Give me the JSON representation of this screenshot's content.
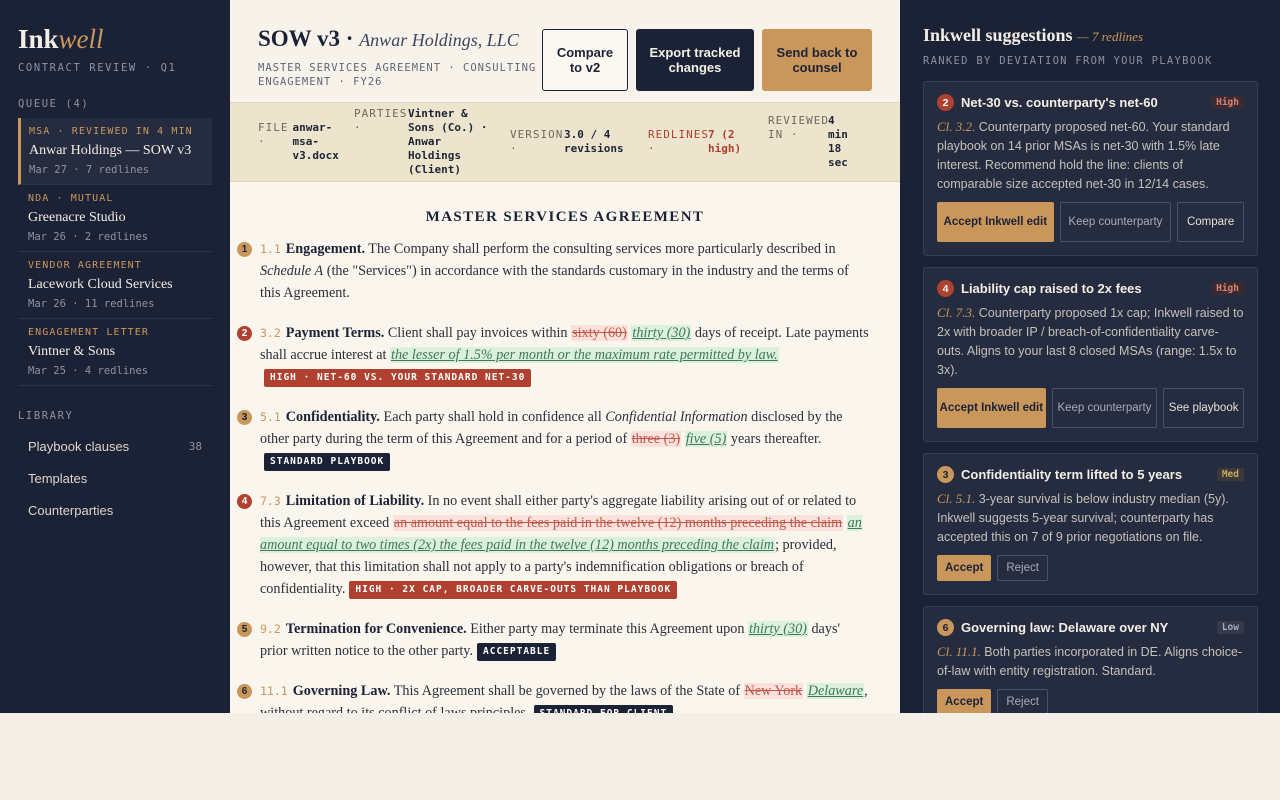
{
  "sidebar": {
    "brand_a": "Ink",
    "brand_b": "well",
    "brand_sub": "CONTRACT REVIEW · Q1",
    "queue_heading": "QUEUE (4)",
    "queue": [
      {
        "tag": "MSA · REVIEWED IN 4 MIN",
        "title": "Anwar Holdings — SOW v3",
        "meta": "Mar 27 · 7 redlines"
      },
      {
        "tag": "NDA · MUTUAL",
        "title": "Greenacre Studio",
        "meta": "Mar 26 · 2 redlines"
      },
      {
        "tag": "VENDOR AGREEMENT",
        "title": "Lacework Cloud Services",
        "meta": "Mar 26 · 11 redlines"
      },
      {
        "tag": "ENGAGEMENT LETTER",
        "title": "Vintner & Sons",
        "meta": "Mar 25 · 4 redlines"
      }
    ],
    "library_heading": "LIBRARY",
    "library": [
      {
        "label": "Playbook clauses",
        "count": "38"
      },
      {
        "label": "Templates",
        "count": ""
      },
      {
        "label": "Counterparties",
        "count": ""
      }
    ]
  },
  "header": {
    "title": "SOW v3 ·",
    "client": "Anwar Holdings, LLC",
    "subtitle": "MASTER SERVICES AGREEMENT · CONSULTING ENGAGEMENT · FY26",
    "compare_label": "Compare to v2",
    "export_label": "Export tracked changes",
    "send_label": "Send back to counsel"
  },
  "meta": {
    "file_label": "FILE ·",
    "file_value": "anwar-msa-v3.docx",
    "parties_label": "PARTIES ·",
    "parties_value": "Vintner & Sons (Co.) · Anwar Holdings (Client)",
    "version_label": "VERSION ·",
    "version_value": "3.0 / 4 revisions",
    "redlines_label": "REDLINES ·",
    "redlines_value": "7 (2 high)",
    "reviewed_label": "REVIEWED IN ·",
    "reviewed_value": "4 min 18 sec"
  },
  "doc": {
    "heading": "MASTER SERVICES AGREEMENT",
    "c1": {
      "marker": "1",
      "num": "1.1",
      "title": "Engagement.",
      "t1": " The Company shall perform the consulting services more particularly described in ",
      "i1": "Schedule A",
      "t2": " (the \"Services\") in accordance with the standards customary in the industry and the terms of this Agreement."
    },
    "c2": {
      "marker": "2",
      "num": "3.2",
      "title": "Payment Terms.",
      "t1": " Client shall pay invoices within ",
      "del1": "sixty (60)",
      "ins1": "thirty (30)",
      "t2": " days of receipt. Late payments shall accrue interest at ",
      "ins2": "the lesser of 1.5% per month or the maximum rate permitted by law.",
      "tag": "HIGH · NET-60 VS. YOUR STANDARD NET-30"
    },
    "c3": {
      "marker": "3",
      "num": "5.1",
      "title": "Confidentiality.",
      "t1": " Each party shall hold in confidence all ",
      "i1": "Confidential Information",
      "t2": " disclosed by the other party during the term of this Agreement and for a period of ",
      "del1": "three (3)",
      "ins1": "five (5)",
      "t3": " years thereafter.",
      "tag": "STANDARD PLAYBOOK"
    },
    "c4": {
      "marker": "4",
      "num": "7.3",
      "title": "Limitation of Liability.",
      "t1": " In no event shall either party's aggregate liability arising out of or related to this Agreement exceed ",
      "del1": "an amount equal to the fees paid in the twelve (12) months preceding the claim",
      "ins1": "an amount equal to two times (2x) the fees paid in the twelve (12) months preceding the claim",
      "t2": "; provided, however, that this limitation shall not apply to a party's indemnification obligations or breach of confidentiality.",
      "tag": "HIGH · 2X CAP, BROADER CARVE-OUTS THAN PLAYBOOK"
    },
    "c5": {
      "marker": "5",
      "num": "9.2",
      "title": "Termination for Convenience.",
      "t1": " Either party may terminate this Agreement upon ",
      "ins1": "thirty (30)",
      "t2": " days' prior written notice to the other party.",
      "tag": "ACCEPTABLE"
    },
    "c6": {
      "marker": "6",
      "num": "11.1",
      "title": "Governing Law.",
      "t1": " This Agreement shall be governed by the laws of the State of ",
      "del1": "New York",
      "ins1": "Delaware",
      "t2": ", without regard to its conflict of laws principles.",
      "tag": "STANDARD FOR CLIENT"
    }
  },
  "panel": {
    "title": "Inkwell suggestions",
    "count": "— 7 redlines",
    "subtitle": "RANKED BY DEVIATION FROM YOUR PLAYBOOK",
    "cards": [
      {
        "num": "2",
        "title": "Net-30 vs. counterparty's net-60",
        "severity": "High",
        "cref": "Cl. 3.2.",
        "text": " Counterparty proposed net-60. Your standard playbook on 14 prior MSAs is net-30 with 1.5% late interest. Recommend hold the line: clients of comparable size accepted net-30 in 12/14 cases.",
        "actions": [
          "Accept Inkwell edit",
          "Keep counterparty",
          "Compare"
        ]
      },
      {
        "num": "4",
        "title": "Liability cap raised to 2x fees",
        "severity": "High",
        "cref": "Cl. 7.3.",
        "text": " Counterparty proposed 1x cap; Inkwell raised to 2x with broader IP / breach-of-confidentiality carve-outs. Aligns to your last 8 closed MSAs (range: 1.5x to 3x).",
        "actions": [
          "Accept Inkwell edit",
          "Keep counterparty",
          "See playbook"
        ]
      },
      {
        "num": "3",
        "title": "Confidentiality term lifted to 5 years",
        "severity": "Med",
        "cref": "Cl. 5.1.",
        "text": " 3-year survival is below industry median (5y). Inkwell suggests 5-year survival; counterparty has accepted this on 7 of 9 prior negotiations on file.",
        "actions": [
          "Accept",
          "Reject"
        ]
      },
      {
        "num": "6",
        "title": "Governing law: Delaware over NY",
        "severity": "Low",
        "cref": "Cl. 11.1.",
        "text": " Both parties incorporated in DE. Aligns choice-of-law with entity registration. Standard.",
        "actions": [
          "Accept",
          "Reject"
        ]
      }
    ]
  },
  "colors": {
    "navy": "#1c2236",
    "gold": "#c9975b",
    "red": "#b0402f",
    "paper": "#faf6ee"
  }
}
